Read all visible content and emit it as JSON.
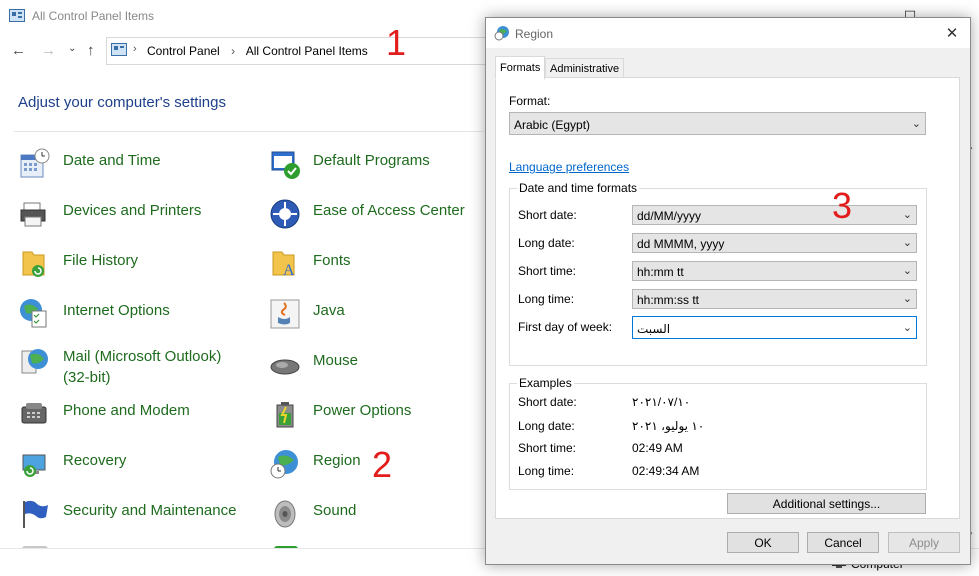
{
  "control_panel": {
    "title": "All Control Panel Items",
    "breadcrumb": [
      "Control Panel",
      "All Control Panel Items"
    ],
    "heading": "Adjust your computer's settings",
    "items_left": [
      {
        "label": "Date and Time",
        "icon": "calendar-clock-icon"
      },
      {
        "label": "Devices and Printers",
        "icon": "printer-icon"
      },
      {
        "label": "File History",
        "icon": "folder-history-icon"
      },
      {
        "label": "Internet Options",
        "icon": "globe-checklist-icon"
      },
      {
        "label": "Mail (Microsoft Outlook)\n(32-bit)",
        "label_line1": "Mail (Microsoft Outlook)",
        "label_line2": "(32-bit)",
        "icon": "mail-icon"
      },
      {
        "label": "Phone and Modem",
        "icon": "phone-icon"
      },
      {
        "label": "Recovery",
        "icon": "recovery-icon"
      },
      {
        "label": "Security and Maintenance",
        "icon": "flag-icon"
      }
    ],
    "items_right": [
      {
        "label": "Default Programs",
        "icon": "default-programs-icon"
      },
      {
        "label": "Ease of Access Center",
        "icon": "ease-of-access-icon"
      },
      {
        "label": "Fonts",
        "icon": "fonts-folder-icon"
      },
      {
        "label": "Java",
        "icon": "java-icon"
      },
      {
        "label": "Mouse",
        "icon": "mouse-icon"
      },
      {
        "label": "Power Options",
        "icon": "battery-icon"
      },
      {
        "label": "Region",
        "icon": "globe-clock-icon"
      },
      {
        "label": "Sound",
        "icon": "speaker-icon"
      }
    ],
    "taskbar_label": "Computer"
  },
  "annotations": [
    "1",
    "2",
    "3"
  ],
  "region_dialog": {
    "title": "Region",
    "tabs": [
      "Formats",
      "Administrative"
    ],
    "format_label": "Format:",
    "format_value": "Arabic (Egypt)",
    "language_link": "Language preferences",
    "date_time_group": "Date and time formats",
    "rows": [
      {
        "label": "Short date:",
        "value": "dd/MM/yyyy"
      },
      {
        "label": "Long date:",
        "value": "dd MMMM, yyyy"
      },
      {
        "label": "Short time:",
        "value": "hh:mm tt"
      },
      {
        "label": "Long time:",
        "value": "hh:mm:ss tt"
      },
      {
        "label": "First day of week:",
        "value": "السبت"
      }
    ],
    "examples_group": "Examples",
    "examples": [
      {
        "label": "Short date:",
        "value": "٢٠٢١/٠٧/١٠"
      },
      {
        "label": "Long date:",
        "value": "١٠ يوليو، ٢٠٢١"
      },
      {
        "label": "Short time:",
        "value": "02:49 AM"
      },
      {
        "label": "Long time:",
        "value": "02:49:34 AM"
      }
    ],
    "additional_settings": "Additional settings...",
    "ok": "OK",
    "cancel": "Cancel",
    "apply": "Apply"
  }
}
